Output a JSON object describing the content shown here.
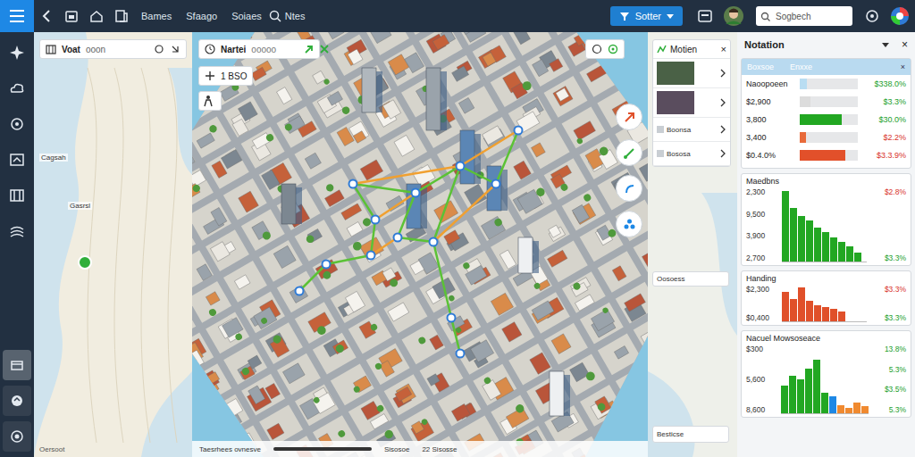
{
  "topbar": {
    "links": [
      "Bames",
      "Sfaago",
      "Soiaes"
    ],
    "notes": "Ntes",
    "button": "Sotter",
    "search": {
      "placeholder": "Sogbech"
    }
  },
  "sidebar": {
    "items": [
      {
        "selected": false
      },
      {
        "selected": false
      },
      {
        "selected": false
      },
      {
        "selected": false
      },
      {
        "selected": false
      },
      {
        "selected": false
      },
      {
        "selected": true
      },
      {
        "selected": false
      },
      {
        "selected": false
      }
    ]
  },
  "left_map": {
    "title": "Voat",
    "subtitle": "ooon",
    "labels": [
      "Cagsah",
      "Gasrsl"
    ],
    "footer": "Oersoot"
  },
  "city": {
    "search": "Nartei",
    "search_hint": "ooooo",
    "scale": "1 BSO",
    "footer": [
      "Taesrhees ovnesve",
      "Sisosoe",
      "22 Sisosse"
    ]
  },
  "motion": {
    "title": "Motien",
    "close": "×",
    "rows": [
      {
        "kind": "photo",
        "label": ""
      },
      {
        "kind": "photo",
        "label": ""
      },
      {
        "kind": "text",
        "label": "Boonsa"
      },
      {
        "kind": "text",
        "label": "Bososa"
      }
    ],
    "list": [
      "Oosoess"
    ],
    "footer": "Besticse"
  },
  "notation": {
    "title": "Notation",
    "close": "×",
    "summary": {
      "headers": [
        "Boxsoe",
        "Enxxe"
      ],
      "close": "×",
      "rows": [
        {
          "label": "Naoopoeen",
          "level": 0.12,
          "color": "#b9ddf2",
          "value": "$338.0%",
          "value_color": "#1a9e2a"
        },
        {
          "label": "$2,900",
          "level": 0.18,
          "color": "#dcdcdc",
          "value": "$3.3%",
          "value_color": "#1a9e2a"
        },
        {
          "label": "3,800",
          "level": 0.72,
          "color": "#22a722",
          "value": "$30.0%",
          "value_color": "#1a9e2a"
        },
        {
          "label": "3,400",
          "level": 0.1,
          "color": "#e86a3a",
          "value": "$2.2%",
          "value_color": "#d8322a"
        },
        {
          "label": "$0.4.0%",
          "level": 0.78,
          "color": "#e2502a",
          "value": "$3.3.9%",
          "value_color": "#d8322a"
        }
      ]
    },
    "charts": [
      {
        "title": "Maedbns",
        "ticks": [
          "2,300",
          "9,500",
          "3,900",
          "2,700"
        ],
        "pcts": [
          {
            "text": "$2.8%",
            "color": "#d8322a"
          },
          {
            "text": "$3.3%",
            "color": "#1a9e2a"
          }
        ],
        "series": [
          {
            "color": "#22a722",
            "values": [
              95,
              72,
              62,
              55,
              46,
              40,
              32,
              27,
              20,
              12
            ]
          }
        ]
      },
      {
        "title": "Handing",
        "ticks": [
          "$2,300",
          "$0,400"
        ],
        "pcts": [
          {
            "text": "$3.3%",
            "color": "#d8322a"
          },
          {
            "text": "$3.3%",
            "color": "#1a9e2a"
          }
        ],
        "series": [
          {
            "color": "#e0502a",
            "values": [
              80,
              60,
              92,
              55,
              45,
              40,
              35,
              28
            ]
          }
        ]
      },
      {
        "title": "Nacuel Mowsoseace",
        "ticks": [
          "$300",
          "5,600",
          "8,600"
        ],
        "pcts": [
          {
            "text": "13.8%",
            "color": "#1a9e2a"
          },
          {
            "text": "5.3%",
            "color": "#1a9e2a"
          },
          {
            "text": "$3.5%",
            "color": "#1a9e2a"
          },
          {
            "text": "5.3%",
            "color": "#1a9e2a"
          }
        ],
        "series": [
          {
            "color": "#22a722",
            "values": [
              40,
              55,
              50,
              65,
              78,
              30
            ]
          },
          {
            "color": "#1e88e5",
            "values": [
              25
            ]
          },
          {
            "color": "#f08a30",
            "values": [
              12,
              8,
              15,
              10
            ]
          }
        ]
      }
    ]
  }
}
